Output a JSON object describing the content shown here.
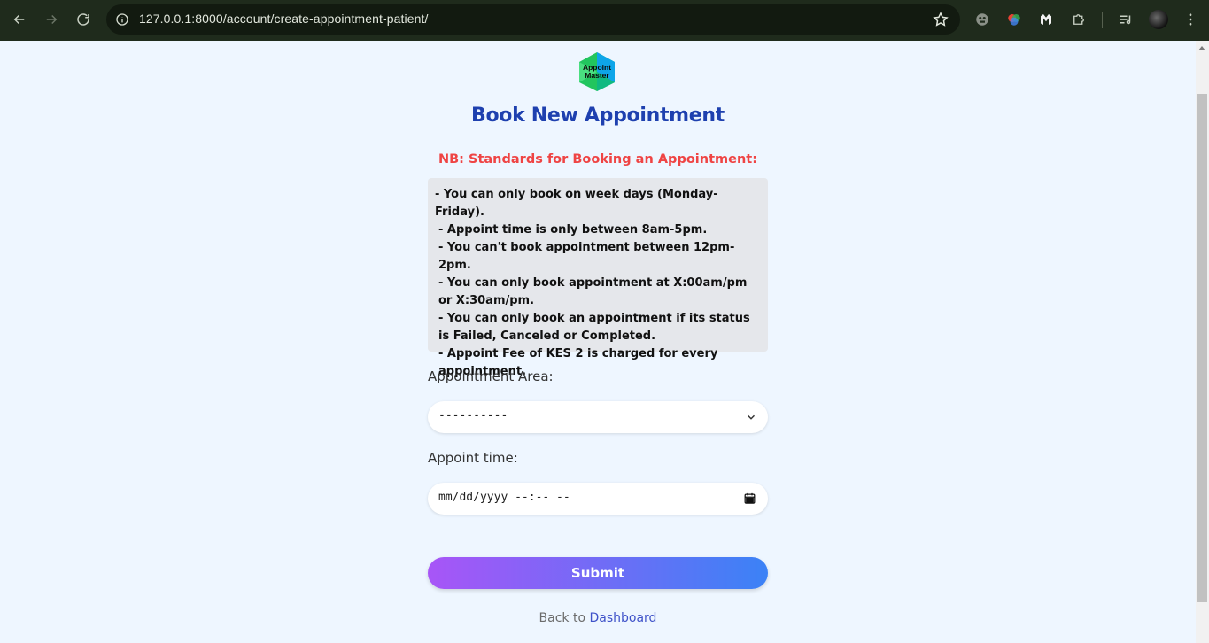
{
  "browser": {
    "url": "127.0.0.1:8000/account/create-appointment-patient/",
    "nav": {
      "back_icon": "arrow-left-icon",
      "forward_icon": "arrow-right-icon",
      "reload_icon": "reload-icon"
    },
    "extensions": [
      "ghost-extension-icon",
      "color-extension-icon",
      "malwarebytes-icon",
      "puzzle-extensions-icon",
      "media-queue-icon"
    ]
  },
  "logo": {
    "line1": "Appoint",
    "line2": "Master"
  },
  "page": {
    "title": "Book New Appointment",
    "nb_heading": "NB: Standards for Booking an Appointment:",
    "rules": [
      "- You can only book on week days (Monday-Friday).",
      "- Appoint time is only between 8am-5pm.",
      "- You can't book appointment between 12pm-2pm.",
      "- You can only book appointment at X:00am/pm or X:30am/pm.",
      "- You can only book an appointment if its status is Failed, Canceled or Completed.",
      "- Appoint Fee of KES 2 is charged for every appointment."
    ]
  },
  "form": {
    "area_label": "Appointment Area:",
    "area_value": "----------",
    "time_label": "Appoint time:",
    "time_placeholder": "mm/dd/yyyy --:-- --",
    "submit_label": "Submit"
  },
  "footer": {
    "back_text": "Back to",
    "dashboard_link": "Dashboard"
  },
  "colors": {
    "title": "#1e40af",
    "nb": "#ef4444",
    "gradient_start": "#a855f7",
    "gradient_end": "#3b82f6",
    "link": "#3f52c9"
  }
}
